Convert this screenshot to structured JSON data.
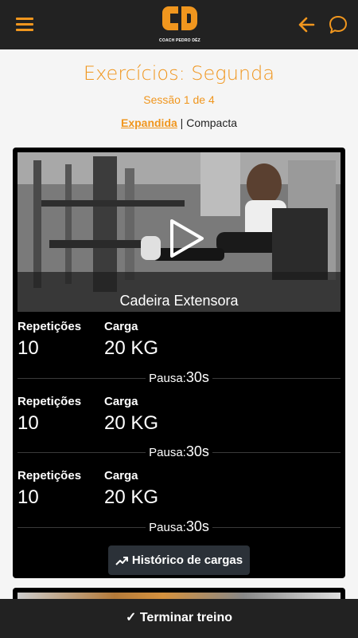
{
  "header": {
    "logo_text": "COACH PEDRO DÉZ",
    "menu_icon": "hamburger-icon",
    "back_icon": "arrow-left-icon",
    "chat_icon": "chat-bubble-icon",
    "accent_color": "#f0961e"
  },
  "page": {
    "title": "Exercícios: Segunda",
    "session": "Sessão 1 de 4",
    "view_expanded": "Expandida",
    "view_separator": " | ",
    "view_compact": "Compacta"
  },
  "exercise": {
    "name": "Cadeira Extensora",
    "sets": [
      {
        "reps_label": "Repetições",
        "reps": "10",
        "load_label": "Carga",
        "load": "20 KG",
        "pause_label": "Pausa:",
        "pause": "30s"
      },
      {
        "reps_label": "Repetições",
        "reps": "10",
        "load_label": "Carga",
        "load": "20 KG",
        "pause_label": "Pausa:",
        "pause": "30s"
      },
      {
        "reps_label": "Repetições",
        "reps": "10",
        "load_label": "Carga",
        "load": "20 KG",
        "pause_label": "Pausa:",
        "pause": "30s"
      }
    ],
    "history_button": "Histórico de cargas",
    "history_icon": "trending-up-icon"
  },
  "footer": {
    "finish_button": "✓ Terminar treino"
  }
}
